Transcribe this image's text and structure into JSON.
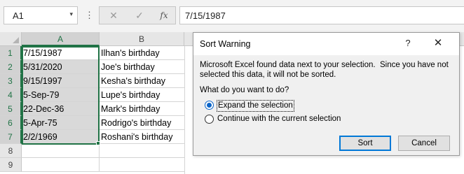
{
  "formula_bar": {
    "name_box": "A1",
    "name_box_arrow": "▾",
    "kebab": "⋮",
    "cancel_glyph": "✕",
    "enter_glyph": "✓",
    "fx_glyph": "fx",
    "formula": "7/15/1987"
  },
  "sheet": {
    "columns": [
      "A",
      "B"
    ],
    "rows": [
      {
        "num": "1",
        "a": "7/15/1987",
        "b": "Ilhan's birthday"
      },
      {
        "num": "2",
        "a": "5/31/2020",
        "b": "Joe's birthday"
      },
      {
        "num": "3",
        "a": "9/15/1997",
        "b": "Kesha's birthday"
      },
      {
        "num": "4",
        "a": "5-Sep-79",
        "b": "Lupe's birthday"
      },
      {
        "num": "5",
        "a": "22-Dec-36",
        "b": "Mark's birthday"
      },
      {
        "num": "6",
        "a": "5-Apr-75",
        "b": "Rodrigo's birthday"
      },
      {
        "num": "7",
        "a": "2/2/1969",
        "b": "Roshani's birthday"
      },
      {
        "num": "8",
        "a": "",
        "b": ""
      },
      {
        "num": "9",
        "a": "",
        "b": ""
      }
    ],
    "selection_color": "#217346"
  },
  "dialog": {
    "title": "Sort Warning",
    "help_glyph": "?",
    "close_glyph": "✕",
    "message_line1": "Microsoft Excel found data next to your selection.  Since you have not",
    "message_line2": "selected this data, it will not be sorted.",
    "question": "What do you want to do?",
    "option_expand": "Expand the selection",
    "option_continue": "Continue with the current selection",
    "selected_option": "expand",
    "sort_button": "Sort",
    "cancel_button": "Cancel"
  }
}
